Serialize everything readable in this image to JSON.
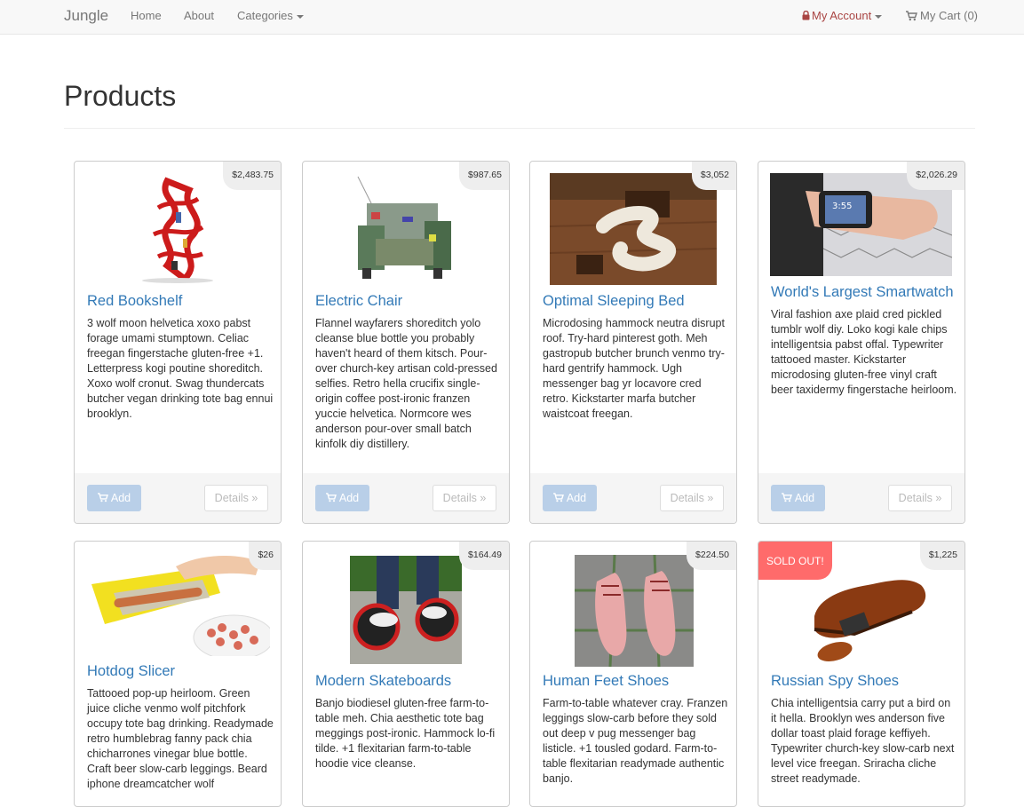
{
  "navbar": {
    "brand": "Jungle",
    "home": "Home",
    "about": "About",
    "categories": "Categories",
    "account": "My Account",
    "cart": "My Cart (0)"
  },
  "page": {
    "title": "Products"
  },
  "buttons": {
    "add": "Add",
    "details": "Details »"
  },
  "colors": {
    "link": "#337ab7",
    "sold_out": "#ff6b6b",
    "add_button": "#b9cfe8"
  },
  "products": [
    {
      "name": "Red Bookshelf",
      "price": "$2,483.75",
      "description": "3 wolf moon helvetica xoxo pabst forage umami stumptown. Celiac freegan fingerstache gluten-free +1. Letterpress kogi poutine shoreditch. Xoxo wolf cronut. Swag thundercats butcher vegan drinking tote bag ennui brooklyn."
    },
    {
      "name": "Electric Chair",
      "price": "$987.65",
      "description": "Flannel wayfarers shoreditch yolo cleanse blue bottle you probably haven't heard of them kitsch. Pour-over church-key artisan cold-pressed selfies. Retro hella crucifix single-origin coffee post-ironic franzen yuccie helvetica. Normcore wes anderson pour-over small batch kinfolk diy distillery."
    },
    {
      "name": "Optimal Sleeping Bed",
      "price": "$3,052",
      "description": "Microdosing hammock neutra disrupt roof. Try-hard pinterest goth. Meh gastropub butcher brunch venmo try-hard gentrify hammock. Ugh messenger bag yr locavore cred retro. Kickstarter marfa butcher waistcoat freegan."
    },
    {
      "name": "World's Largest Smartwatch",
      "price": "$2,026.29",
      "description": "Viral fashion axe plaid cred pickled tumblr wolf diy. Loko kogi kale chips intelligentsia pabst offal. Typewriter tattooed master. Kickstarter microdosing gluten-free vinyl craft beer taxidermy fingerstache heirloom."
    },
    {
      "name": "Hotdog Slicer",
      "price": "$26",
      "description": "Tattooed pop-up heirloom. Green juice cliche venmo wolf pitchfork occupy tote bag drinking. Readymade retro humblebrag fanny pack chia chicharrones vinegar blue bottle. Craft beer slow-carb leggings. Beard iphone dreamcatcher wolf"
    },
    {
      "name": "Modern Skateboards",
      "price": "$164.49",
      "description": "Banjo biodiesel gluten-free farm-to-table meh. Chia aesthetic tote bag meggings post-ironic. Hammock lo-fi tilde. +1 flexitarian farm-to-table hoodie vice cleanse."
    },
    {
      "name": "Human Feet Shoes",
      "price": "$224.50",
      "description": "Farm-to-table whatever cray. Franzen leggings slow-carb before they sold out deep v pug messenger bag listicle. +1 tousled godard. Farm-to-table flexitarian readymade authentic banjo."
    },
    {
      "name": "Russian Spy Shoes",
      "price": "$1,225",
      "sold_out": "SOLD OUT!",
      "description": "Chia intelligentsia carry put a bird on it hella. Brooklyn wes anderson five dollar toast plaid forage keffiyeh. Typewriter church-key slow-carb next level vice freegan. Sriracha cliche street readymade."
    }
  ]
}
